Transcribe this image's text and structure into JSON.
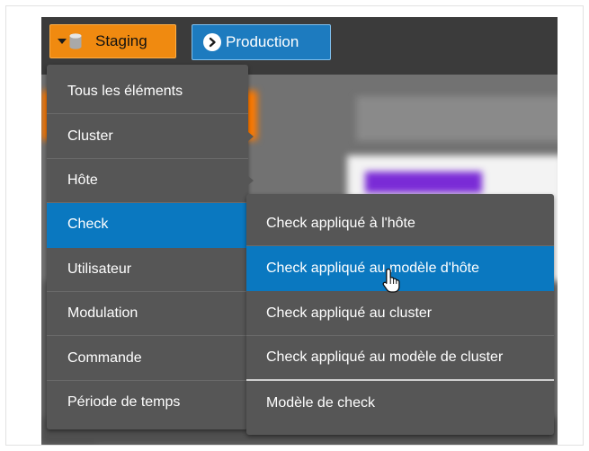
{
  "environments": {
    "staging": {
      "label": "Staging",
      "icon": "database-icon",
      "color": "#f08a10"
    },
    "production": {
      "label": "Production",
      "icon": "arrow-right-circle-icon",
      "color": "#1d7bbf"
    }
  },
  "menu": {
    "items": [
      {
        "label": "Tous les éléments"
      },
      {
        "label": "Cluster"
      },
      {
        "label": "Hôte"
      },
      {
        "label": "Check"
      },
      {
        "label": "Utilisateur"
      },
      {
        "label": "Modulation"
      },
      {
        "label": "Commande"
      },
      {
        "label": "Période de temps"
      }
    ],
    "active": "Check",
    "accent": "#0a78c0"
  },
  "submenu": {
    "items": [
      {
        "label": "Check appliqué à l'hôte"
      },
      {
        "label": "Check appliqué au modèle d'hôte"
      },
      {
        "label": "Check appliqué au cluster"
      },
      {
        "label": "Check appliqué au modèle de cluster"
      },
      {
        "label": "Modèle de check"
      }
    ],
    "hovered": "Check appliqué au modèle d'hôte"
  }
}
